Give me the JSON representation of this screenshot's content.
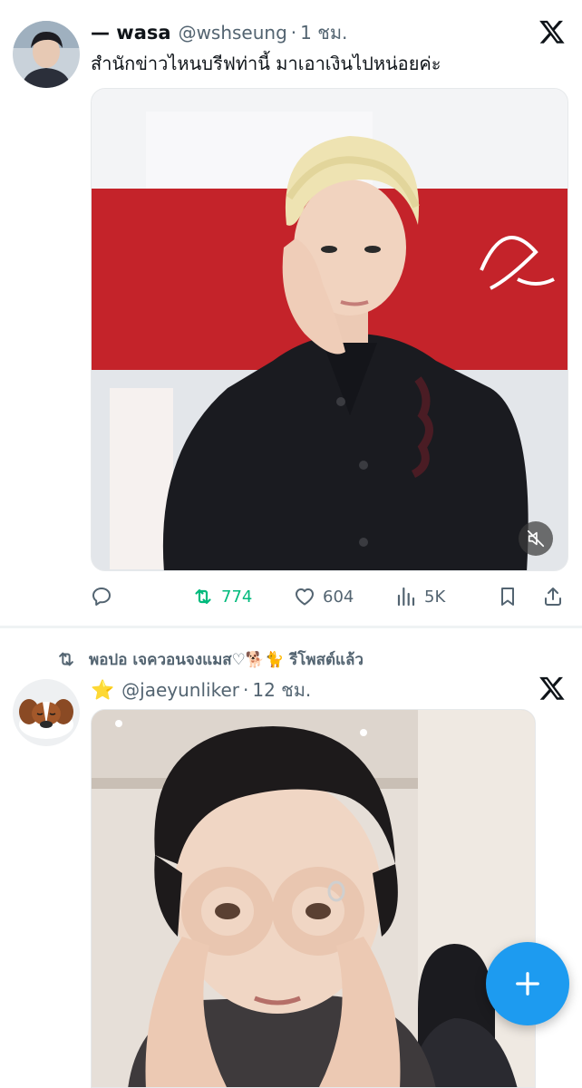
{
  "tweets": [
    {
      "display_name": "— wasa",
      "handle": "@wshseung",
      "time": "1 ชม.",
      "text": "สำนักข่าวไหนบรีฟท่านี้ มาเอาเงินไปหน่อยค่ะ",
      "media_type": "video",
      "media_muted": true,
      "stats": {
        "replies": "",
        "retweets": "774",
        "likes": "604",
        "views": "5K"
      }
    },
    {
      "repost_by": "พอปอ เจควอนจงแมส♡🐕🐈 รีโพสต์แล้ว",
      "display_name": "⭐",
      "handle": "@jaeyunliker",
      "time": "12 ชม.",
      "media_type": "photo"
    }
  ],
  "icons": {
    "reply": "reply-icon",
    "retweet": "retweet-icon",
    "like": "heart-icon",
    "views": "views-icon",
    "bookmark": "bookmark-icon",
    "share": "share-icon",
    "mute": "mute-icon",
    "compose": "compose-plus-icon",
    "x": "x-logo-icon"
  },
  "colors": {
    "accent": "#1d9bf0",
    "retweet_active": "#00ba7c",
    "secondary_text": "#536471",
    "primary_text": "#0f1419"
  }
}
